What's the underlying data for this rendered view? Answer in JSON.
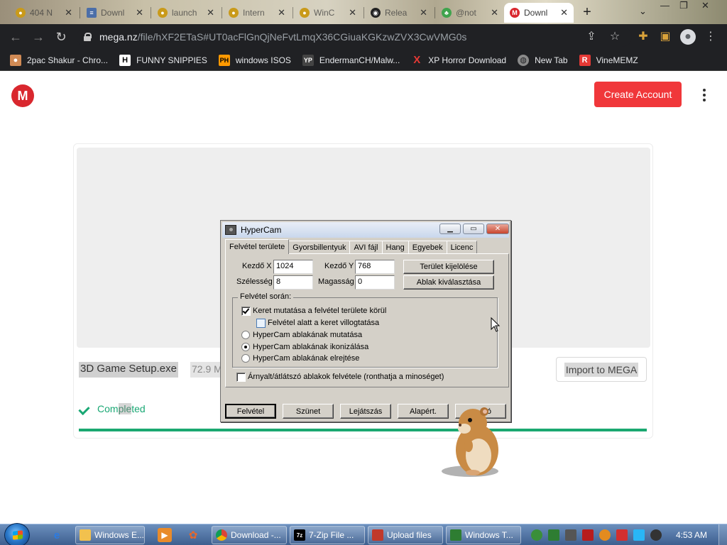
{
  "browser": {
    "tabs": [
      {
        "label": "404 N",
        "favicon": "coin-icon",
        "favicon_color": "#c99a1a"
      },
      {
        "label": "Downl",
        "favicon": "document-icon",
        "favicon_color": "#4b6ea8"
      },
      {
        "label": "launch",
        "favicon": "coin-icon",
        "favicon_color": "#c99a1a"
      },
      {
        "label": "Intern",
        "favicon": "coin-icon",
        "favicon_color": "#c99a1a"
      },
      {
        "label": "WinC",
        "favicon": "coin-icon",
        "favicon_color": "#c99a1a"
      },
      {
        "label": "Relea",
        "favicon": "github-icon",
        "favicon_color": "#222222"
      },
      {
        "label": "@not",
        "favicon": "leaf-icon",
        "favicon_color": "#3fa34d"
      },
      {
        "label": "Downl",
        "favicon": "mega-icon",
        "favicon_color": "#d9272e",
        "active": true
      }
    ],
    "address": {
      "host": "mega.nz",
      "path": "/file/hXF2ETaS#UT0acFlGnQjNeFvtLmqX36CGiuaKGKzwZVX3CwVMG0s"
    },
    "bookmarks": [
      {
        "label": "2pac Shakur - Chro...",
        "icon": "profile-icon",
        "color": "#d08a55"
      },
      {
        "label": "FUNNY SNIPPIES",
        "icon": "h-icon",
        "color": "#ffffff"
      },
      {
        "label": "windows ISOS",
        "icon": "ph-icon",
        "color": "#ff9900"
      },
      {
        "label": "EndermanCH/Malw...",
        "icon": "yp-icon",
        "color": "#444444"
      },
      {
        "label": "XP Horror Download",
        "icon": "x-icon",
        "color": "#e53935"
      },
      {
        "label": "New Tab",
        "icon": "globe-icon",
        "color": "#8a8a8a"
      },
      {
        "label": "VineMEMZ",
        "icon": "r-icon",
        "color": "#e53935"
      }
    ]
  },
  "mega": {
    "logo": "M",
    "create_account": "Create Account",
    "file_name": "3D Game Setup.exe",
    "file_size": "72.9 M",
    "import_button": "Import to MEGA",
    "status_prefix": "Com",
    "status_highlight": "ple",
    "status_suffix": "ted",
    "progress": 1.0,
    "accent": "#d9272e",
    "success_color": "#19a874"
  },
  "hypercam": {
    "title": "HyperCam",
    "tabs": [
      "Felvétel területe",
      "Gyorsbillentyuk",
      "AVI fájl",
      "Hang",
      "Egyebek",
      "Licenc"
    ],
    "start_x_label": "Kezdő X",
    "start_x_value": "1024",
    "start_y_label": "Kezdő Y",
    "start_y_value": "768",
    "width_label": "Szélesség",
    "width_value": "8",
    "height_label": "Magasság",
    "height_value": "0",
    "select_area_button": "Terület kijelölése",
    "select_window_button": "Ablak kiválasztása",
    "group_title": "Felvétel során:",
    "options": {
      "show_frame": "Keret mutatása a felvétel területe körül",
      "blink_frame": "Felvétel alatt a keret villogtatása",
      "show_window": "HyperCam ablakának mutatása",
      "iconize_window": "HyperCam ablakának ikonizálása",
      "hide_window": "HyperCam ablakának elrejtése",
      "layered": "Árnyalt/átlátszó ablakok felvétele (ronthatja a minoséget)"
    },
    "buttons": {
      "record": "Felvétel",
      "pause": "Szünet",
      "play": "Lejátszás",
      "default": "Alapért.",
      "last": "ó"
    }
  },
  "taskbar": {
    "items": [
      {
        "label": "Windows E...",
        "icon": "folder-icon",
        "color": "#f2c14e"
      },
      {
        "label": "Download -...",
        "icon": "chrome-icon",
        "color": "#db4437"
      },
      {
        "label": "7-Zip File ...",
        "icon": "7zip-icon",
        "color": "#000000"
      },
      {
        "label": "Upload files",
        "icon": "upload-icon",
        "color": "#c0392b"
      },
      {
        "label": "Windows T...",
        "icon": "monitor-icon",
        "color": "#2e7d32"
      }
    ],
    "clock": "4:53 AM"
  }
}
